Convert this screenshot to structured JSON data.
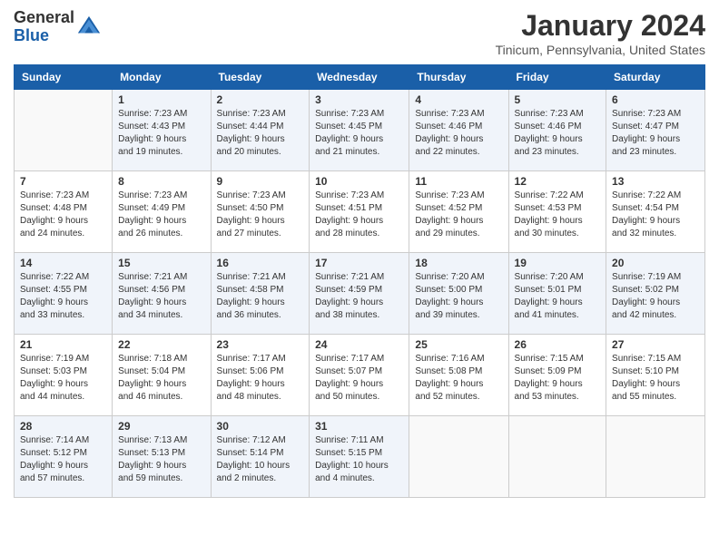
{
  "header": {
    "logo_line1": "General",
    "logo_line2": "Blue",
    "month_year": "January 2024",
    "location": "Tinicum, Pennsylvania, United States"
  },
  "days_of_week": [
    "Sunday",
    "Monday",
    "Tuesday",
    "Wednesday",
    "Thursday",
    "Friday",
    "Saturday"
  ],
  "weeks": [
    [
      {
        "day": "",
        "info": ""
      },
      {
        "day": "1",
        "info": "Sunrise: 7:23 AM\nSunset: 4:43 PM\nDaylight: 9 hours\nand 19 minutes."
      },
      {
        "day": "2",
        "info": "Sunrise: 7:23 AM\nSunset: 4:44 PM\nDaylight: 9 hours\nand 20 minutes."
      },
      {
        "day": "3",
        "info": "Sunrise: 7:23 AM\nSunset: 4:45 PM\nDaylight: 9 hours\nand 21 minutes."
      },
      {
        "day": "4",
        "info": "Sunrise: 7:23 AM\nSunset: 4:46 PM\nDaylight: 9 hours\nand 22 minutes."
      },
      {
        "day": "5",
        "info": "Sunrise: 7:23 AM\nSunset: 4:46 PM\nDaylight: 9 hours\nand 23 minutes."
      },
      {
        "day": "6",
        "info": "Sunrise: 7:23 AM\nSunset: 4:47 PM\nDaylight: 9 hours\nand 23 minutes."
      }
    ],
    [
      {
        "day": "7",
        "info": ""
      },
      {
        "day": "8",
        "info": "Sunrise: 7:23 AM\nSunset: 4:49 PM\nDaylight: 9 hours\nand 26 minutes."
      },
      {
        "day": "9",
        "info": "Sunrise: 7:23 AM\nSunset: 4:50 PM\nDaylight: 9 hours\nand 27 minutes."
      },
      {
        "day": "10",
        "info": "Sunrise: 7:23 AM\nSunset: 4:51 PM\nDaylight: 9 hours\nand 28 minutes."
      },
      {
        "day": "11",
        "info": "Sunrise: 7:23 AM\nSunset: 4:52 PM\nDaylight: 9 hours\nand 29 minutes."
      },
      {
        "day": "12",
        "info": "Sunrise: 7:22 AM\nSunset: 4:53 PM\nDaylight: 9 hours\nand 30 minutes."
      },
      {
        "day": "13",
        "info": "Sunrise: 7:22 AM\nSunset: 4:54 PM\nDaylight: 9 hours\nand 32 minutes."
      }
    ],
    [
      {
        "day": "14",
        "info": "Sunrise: 7:22 AM\nSunset: 4:55 PM\nDaylight: 9 hours\nand 33 minutes."
      },
      {
        "day": "15",
        "info": "Sunrise: 7:21 AM\nSunset: 4:56 PM\nDaylight: 9 hours\nand 34 minutes."
      },
      {
        "day": "16",
        "info": "Sunrise: 7:21 AM\nSunset: 4:58 PM\nDaylight: 9 hours\nand 36 minutes."
      },
      {
        "day": "17",
        "info": "Sunrise: 7:21 AM\nSunset: 4:59 PM\nDaylight: 9 hours\nand 38 minutes."
      },
      {
        "day": "18",
        "info": "Sunrise: 7:20 AM\nSunset: 5:00 PM\nDaylight: 9 hours\nand 39 minutes."
      },
      {
        "day": "19",
        "info": "Sunrise: 7:20 AM\nSunset: 5:01 PM\nDaylight: 9 hours\nand 41 minutes."
      },
      {
        "day": "20",
        "info": "Sunrise: 7:19 AM\nSunset: 5:02 PM\nDaylight: 9 hours\nand 42 minutes."
      }
    ],
    [
      {
        "day": "21",
        "info": "Sunrise: 7:19 AM\nSunset: 5:03 PM\nDaylight: 9 hours\nand 44 minutes."
      },
      {
        "day": "22",
        "info": "Sunrise: 7:18 AM\nSunset: 5:04 PM\nDaylight: 9 hours\nand 46 minutes."
      },
      {
        "day": "23",
        "info": "Sunrise: 7:17 AM\nSunset: 5:06 PM\nDaylight: 9 hours\nand 48 minutes."
      },
      {
        "day": "24",
        "info": "Sunrise: 7:17 AM\nSunset: 5:07 PM\nDaylight: 9 hours\nand 50 minutes."
      },
      {
        "day": "25",
        "info": "Sunrise: 7:16 AM\nSunset: 5:08 PM\nDaylight: 9 hours\nand 52 minutes."
      },
      {
        "day": "26",
        "info": "Sunrise: 7:15 AM\nSunset: 5:09 PM\nDaylight: 9 hours\nand 53 minutes."
      },
      {
        "day": "27",
        "info": "Sunrise: 7:15 AM\nSunset: 5:10 PM\nDaylight: 9 hours\nand 55 minutes."
      }
    ],
    [
      {
        "day": "28",
        "info": "Sunrise: 7:14 AM\nSunset: 5:12 PM\nDaylight: 9 hours\nand 57 minutes."
      },
      {
        "day": "29",
        "info": "Sunrise: 7:13 AM\nSunset: 5:13 PM\nDaylight: 9 hours\nand 59 minutes."
      },
      {
        "day": "30",
        "info": "Sunrise: 7:12 AM\nSunset: 5:14 PM\nDaylight: 10 hours\nand 2 minutes."
      },
      {
        "day": "31",
        "info": "Sunrise: 7:11 AM\nSunset: 5:15 PM\nDaylight: 10 hours\nand 4 minutes."
      },
      {
        "day": "",
        "info": ""
      },
      {
        "day": "",
        "info": ""
      },
      {
        "day": "",
        "info": ""
      }
    ]
  ],
  "week7_sunday": {
    "info": "Sunrise: 7:23 AM\nSunset: 4:48 PM\nDaylight: 9 hours\nand 24 minutes."
  }
}
